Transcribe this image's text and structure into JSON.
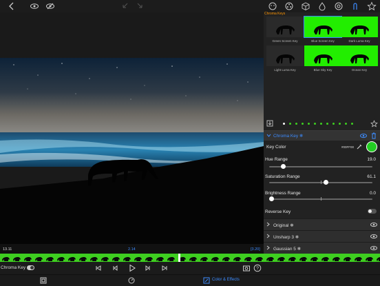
{
  "toolbar": {
    "icons_left": [
      "back-chevron-icon",
      "eye-icon",
      "eye-settings-icon",
      "undo-icon",
      "redo-icon"
    ],
    "icons_right": [
      "face-icon",
      "palette-icon",
      "cube-icon",
      "drop-icon",
      "compass-icon",
      "color-key-icon",
      "star-icon"
    ]
  },
  "gallery": {
    "title": "Chroma Keys",
    "presets": [
      {
        "label": "Green Screen Key"
      },
      {
        "label": "Blue Screen Key"
      },
      {
        "label": "Dark Luma Key"
      },
      {
        "label": "Light Luma Key"
      },
      {
        "label": "Blue Sky Key"
      },
      {
        "label": "Ocean Key"
      }
    ],
    "selected_index": 1,
    "page_count": 12,
    "current_page": 0
  },
  "effect": {
    "name": "Chroma Key ❄",
    "key_color_label": "Key Color",
    "key_color_hex": "#00FF00",
    "key_color": "#22cc22",
    "hue": {
      "label": "Hue Range",
      "value": "19.0",
      "fraction": 0.12
    },
    "saturation": {
      "label": "Saturation Range",
      "value": "61.1",
      "fraction": 0.55
    },
    "brightness": {
      "label": "Brightness Range",
      "value": "0.0",
      "fraction": 0.0
    },
    "reverse": {
      "label": "Reverse Key",
      "on": false
    }
  },
  "stack": [
    {
      "name": "Original ❄"
    },
    {
      "name": "Unsharp 3 ❄"
    },
    {
      "name": "Gaussian 5 ❄"
    }
  ],
  "timeline": {
    "left_time": "13.11",
    "center_time": "2.14",
    "right_time": "[3.20]",
    "playhead_fraction": 0.47
  },
  "playback": {
    "layer_name": "Chroma Key",
    "toggle_on": true,
    "buttons": [
      "skip-start-icon",
      "step-back-icon",
      "play-icon",
      "step-forward-icon",
      "skip-end-icon"
    ]
  },
  "bottom": {
    "fit_icon": "fit-icon",
    "speed_icon": "speed-icon",
    "tab_label": "Color & Effects",
    "accent": "#3d8cff"
  }
}
